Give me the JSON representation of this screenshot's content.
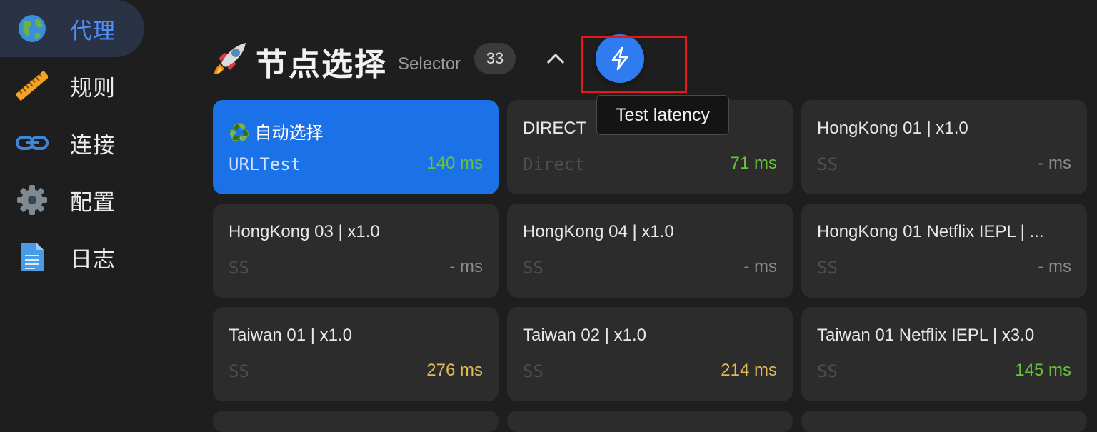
{
  "sidebar": {
    "items": [
      {
        "label": "代理",
        "icon": "earth-globe-icon",
        "active": true
      },
      {
        "label": "规则",
        "icon": "ruler-icon",
        "active": false
      },
      {
        "label": "连接",
        "icon": "link-icon",
        "active": false
      },
      {
        "label": "配置",
        "icon": "gear-icon",
        "active": false
      },
      {
        "label": "日志",
        "icon": "document-icon",
        "active": false
      }
    ]
  },
  "group": {
    "icon": "rocket-icon",
    "title": "节点选择",
    "type": "Selector",
    "count": "33",
    "collapse_icon": "chevron-up-icon",
    "test_button_icon": "lightning-icon",
    "tooltip": "Test latency"
  },
  "proxies": [
    {
      "name": "♻️ 自动选择",
      "type": "URLTest",
      "delay": "140 ms",
      "status": "good",
      "selected": true
    },
    {
      "name": "DIRECT",
      "type": "Direct",
      "delay": "71 ms",
      "status": "good",
      "selected": false
    },
    {
      "name": "HongKong 01 | x1.0",
      "type": "SS",
      "delay": "- ms",
      "status": "none",
      "selected": false
    },
    {
      "name": "HongKong 03 | x1.0",
      "type": "SS",
      "delay": "- ms",
      "status": "none",
      "selected": false
    },
    {
      "name": "HongKong 04 | x1.0",
      "type": "SS",
      "delay": "- ms",
      "status": "none",
      "selected": false
    },
    {
      "name": "HongKong 01 Netflix IEPL | ...",
      "type": "SS",
      "delay": "- ms",
      "status": "none",
      "selected": false
    },
    {
      "name": "Taiwan 01 | x1.0",
      "type": "SS",
      "delay": "276 ms",
      "status": "mid",
      "selected": false
    },
    {
      "name": "Taiwan 02 | x1.0",
      "type": "SS",
      "delay": "214 ms",
      "status": "mid",
      "selected": false
    },
    {
      "name": "Taiwan 01 Netflix IEPL | x3.0",
      "type": "SS",
      "delay": "145 ms",
      "status": "good",
      "selected": false
    }
  ],
  "colors": {
    "background": "#1e1e1e",
    "card": "#2c2c2c",
    "selected_card": "#1b72e8",
    "accent": "#2f7cf0",
    "delay_good": "#66c23a",
    "delay_mid": "#e0b75b",
    "highlight": "#e5161d"
  }
}
